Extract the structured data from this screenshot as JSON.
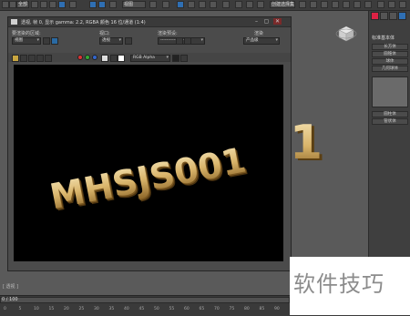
{
  "toolbar": {
    "selection_set": "全部",
    "ref_coord": "视图",
    "named_sel": "创建选择集"
  },
  "viewport": {
    "label": "[ 透视 ]"
  },
  "render_window": {
    "title": "透视, 帧 0, 显示 gamma: 2.2, RGBA 颜色 16 位/通道 (1:4)",
    "area_label": "要渲染的区域:",
    "area_value": "视图",
    "viewport_label": "视口:",
    "viewport_value": "透视",
    "preset_label": "渲染预设:",
    "preset_value": "-------------------",
    "render_label": "渲染",
    "render_value": "产品级",
    "channel_value": "RGB Alpha"
  },
  "render_text": "MHSJS001",
  "viewport_text": "1",
  "command_panel": {
    "header": "标准基本体",
    "items": [
      "长方体",
      "圆锥体",
      "球体",
      "几何球体",
      "圆柱体",
      "管状体"
    ]
  },
  "timeline": {
    "frame_counter": "0 / 100",
    "ticks": [
      "0",
      "5",
      "10",
      "15",
      "20",
      "25",
      "30",
      "35",
      "40",
      "45",
      "50",
      "55",
      "60",
      "65",
      "70",
      "75",
      "80",
      "85",
      "90"
    ]
  },
  "watermark": "软件技巧",
  "colors": {
    "gold_light": "#f6e6b8",
    "gold_mid": "#d9b46a",
    "gold_dark": "#8a6326",
    "ui_blue": "#2f6fb3"
  }
}
